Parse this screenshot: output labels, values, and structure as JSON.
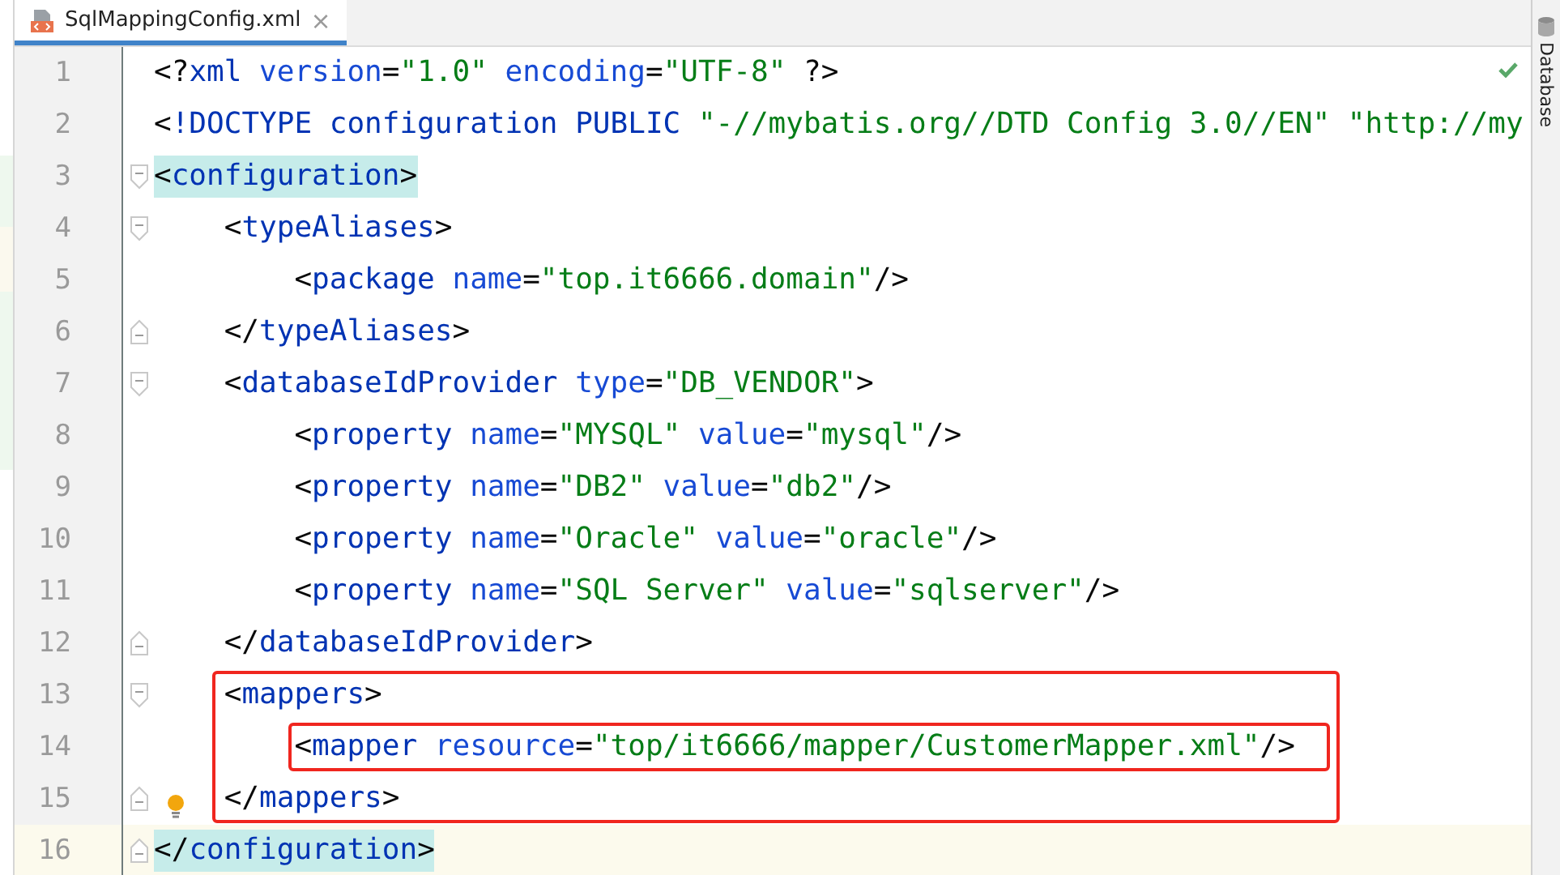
{
  "tab": {
    "label": "SqlMappingConfig.xml",
    "close": "×",
    "selected": true
  },
  "side_strip": {
    "label": "Database"
  },
  "code": [
    {
      "kind": "line",
      "number": "1",
      "tokens": [
        {
          "kind": "punct",
          "text": "<?"
        },
        {
          "kind": "tag",
          "text": "xml"
        },
        {
          "kind": "attr",
          "text": " version"
        },
        {
          "kind": "punct",
          "text": "="
        },
        {
          "kind": "value",
          "text": "\"1.0\""
        },
        {
          "kind": "attr",
          "text": " encoding"
        },
        {
          "kind": "punct",
          "text": "="
        },
        {
          "kind": "value",
          "text": "\"UTF-8\""
        },
        {
          "kind": "punct",
          "text": " ?>"
        }
      ]
    },
    {
      "kind": "line",
      "number": "2",
      "tokens": [
        {
          "kind": "punct",
          "text": "<"
        },
        {
          "kind": "tag",
          "text": "!DOCTYPE configuration PUBLIC "
        },
        {
          "kind": "value",
          "text": "\"-//mybatis.org//DTD Config 3.0//EN\" \"http://my"
        }
      ]
    },
    {
      "kind": "element",
      "open": {
        "number": "3",
        "matched": true,
        "tokens": [
          {
            "kind": "punct",
            "text": "<"
          },
          {
            "kind": "tag",
            "text": "configuration"
          },
          {
            "kind": "punct",
            "text": ">"
          }
        ]
      },
      "close": {
        "number": "16",
        "matched": true,
        "current": true,
        "tokens": [
          {
            "kind": "punct",
            "text": "</"
          },
          {
            "kind": "tag",
            "text": "configuration"
          },
          {
            "kind": "punct",
            "text": ">"
          }
        ]
      },
      "children": [
        {
          "kind": "element",
          "open": {
            "number": "4",
            "tokens": [
              {
                "kind": "punct",
                "text": "<"
              },
              {
                "kind": "tag",
                "text": "typeAliases"
              },
              {
                "kind": "punct",
                "text": ">"
              }
            ]
          },
          "close": {
            "number": "6",
            "tokens": [
              {
                "kind": "punct",
                "text": "</"
              },
              {
                "kind": "tag",
                "text": "typeAliases"
              },
              {
                "kind": "punct",
                "text": ">"
              }
            ]
          },
          "children": [
            {
              "kind": "line",
              "number": "5",
              "tokens": [
                {
                  "kind": "punct",
                  "text": "<"
                },
                {
                  "kind": "tag",
                  "text": "package"
                },
                {
                  "kind": "attr",
                  "text": " name"
                },
                {
                  "kind": "punct",
                  "text": "="
                },
                {
                  "kind": "value",
                  "text": "\"top.it6666.domain\""
                },
                {
                  "kind": "punct",
                  "text": "/>"
                }
              ]
            }
          ]
        },
        {
          "kind": "element",
          "open": {
            "number": "7",
            "tokens": [
              {
                "kind": "punct",
                "text": "<"
              },
              {
                "kind": "tag",
                "text": "databaseIdProvider"
              },
              {
                "kind": "attr",
                "text": " type"
              },
              {
                "kind": "punct",
                "text": "="
              },
              {
                "kind": "value",
                "text": "\"DB_VENDOR\""
              },
              {
                "kind": "punct",
                "text": ">"
              }
            ]
          },
          "close": {
            "number": "12",
            "tokens": [
              {
                "kind": "punct",
                "text": "</"
              },
              {
                "kind": "tag",
                "text": "databaseIdProvider"
              },
              {
                "kind": "punct",
                "text": ">"
              }
            ]
          },
          "children": [
            {
              "kind": "line",
              "number": "8",
              "tokens": [
                {
                  "kind": "punct",
                  "text": "<"
                },
                {
                  "kind": "tag",
                  "text": "property"
                },
                {
                  "kind": "attr",
                  "text": " name"
                },
                {
                  "kind": "punct",
                  "text": "="
                },
                {
                  "kind": "value",
                  "text": "\"MYSQL\""
                },
                {
                  "kind": "attr",
                  "text": " value"
                },
                {
                  "kind": "punct",
                  "text": "="
                },
                {
                  "kind": "value",
                  "text": "\"mysql\""
                },
                {
                  "kind": "punct",
                  "text": "/>"
                }
              ]
            },
            {
              "kind": "line",
              "number": "9",
              "tokens": [
                {
                  "kind": "punct",
                  "text": "<"
                },
                {
                  "kind": "tag",
                  "text": "property"
                },
                {
                  "kind": "attr",
                  "text": " name"
                },
                {
                  "kind": "punct",
                  "text": "="
                },
                {
                  "kind": "value",
                  "text": "\"DB2\""
                },
                {
                  "kind": "attr",
                  "text": " value"
                },
                {
                  "kind": "punct",
                  "text": "="
                },
                {
                  "kind": "value",
                  "text": "\"db2\""
                },
                {
                  "kind": "punct",
                  "text": "/>"
                }
              ]
            },
            {
              "kind": "line",
              "number": "10",
              "tokens": [
                {
                  "kind": "punct",
                  "text": "<"
                },
                {
                  "kind": "tag",
                  "text": "property"
                },
                {
                  "kind": "attr",
                  "text": " name"
                },
                {
                  "kind": "punct",
                  "text": "="
                },
                {
                  "kind": "value",
                  "text": "\"Oracle\""
                },
                {
                  "kind": "attr",
                  "text": " value"
                },
                {
                  "kind": "punct",
                  "text": "="
                },
                {
                  "kind": "value",
                  "text": "\"oracle\""
                },
                {
                  "kind": "punct",
                  "text": "/>"
                }
              ]
            },
            {
              "kind": "line",
              "number": "11",
              "tokens": [
                {
                  "kind": "punct",
                  "text": "<"
                },
                {
                  "kind": "tag",
                  "text": "property"
                },
                {
                  "kind": "attr",
                  "text": " name"
                },
                {
                  "kind": "punct",
                  "text": "="
                },
                {
                  "kind": "value",
                  "text": "\"SQL Server\""
                },
                {
                  "kind": "attr",
                  "text": " value"
                },
                {
                  "kind": "punct",
                  "text": "="
                },
                {
                  "kind": "value",
                  "text": "\"sqlserver\""
                },
                {
                  "kind": "punct",
                  "text": "/>"
                }
              ]
            }
          ]
        },
        {
          "kind": "element",
          "framed": true,
          "open": {
            "number": "13",
            "tokens": [
              {
                "kind": "punct",
                "text": "<"
              },
              {
                "kind": "tag",
                "text": "mappers"
              },
              {
                "kind": "punct",
                "text": ">"
              }
            ]
          },
          "close": {
            "number": "15",
            "intention": true,
            "tokens": [
              {
                "kind": "punct",
                "text": "</"
              },
              {
                "kind": "tag",
                "text": "mappers"
              },
              {
                "kind": "punct",
                "text": ">"
              }
            ]
          },
          "children": [
            {
              "kind": "line",
              "number": "14",
              "framed": true,
              "tokens": [
                {
                  "kind": "punct",
                  "text": "<"
                },
                {
                  "kind": "tag",
                  "text": "mapper"
                },
                {
                  "kind": "attr",
                  "text": " resource"
                },
                {
                  "kind": "punct",
                  "text": "="
                },
                {
                  "kind": "value",
                  "text": "\"top/it6666/mapper/CustomerMapper.xml\""
                },
                {
                  "kind": "punct",
                  "text": "/>"
                }
              ]
            }
          ]
        }
      ]
    }
  ]
}
